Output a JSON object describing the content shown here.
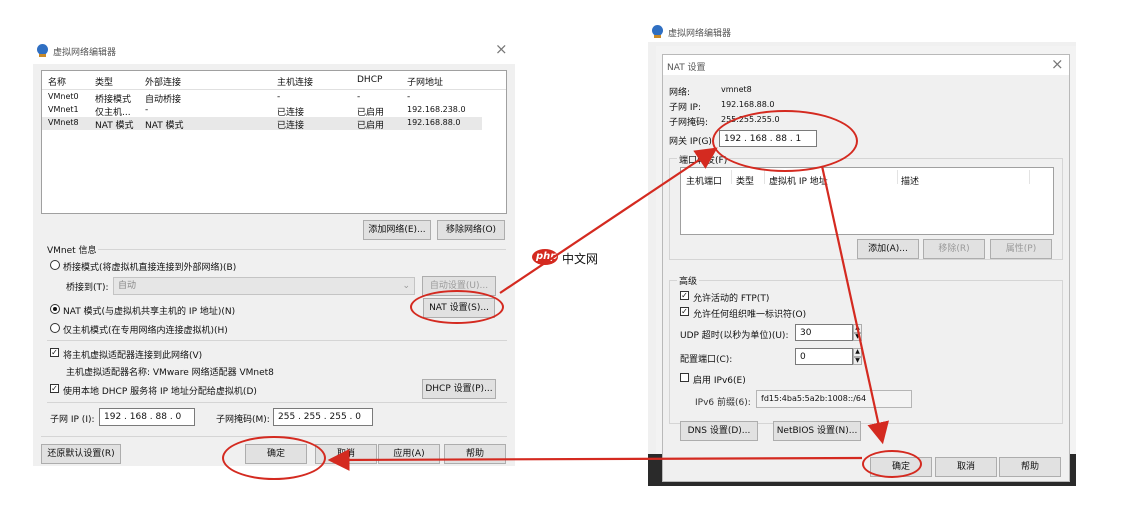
{
  "left": {
    "title": "虚拟网络编辑器",
    "close": "×",
    "table": {
      "headers": [
        "名称",
        "类型",
        "外部连接",
        "主机连接",
        "DHCP",
        "子网地址"
      ],
      "rows": [
        [
          "VMnet0",
          "桥接模式",
          "自动桥接",
          "-",
          "-",
          "-"
        ],
        [
          "VMnet1",
          "仅主机...",
          "-",
          "已连接",
          "已启用",
          "192.168.238.0"
        ],
        [
          "VMnet8",
          "NAT 模式",
          "NAT 模式",
          "已连接",
          "已启用",
          "192.168.88.0"
        ]
      ]
    },
    "add_network": "添加网络(E)...",
    "remove_network": "移除网络(O)",
    "vmnet_info": "VMnet 信息",
    "bridge_mode": "桥接模式(将虚拟机直接连接到外部网络)(B)",
    "bridge_to_label": "桥接到(T):",
    "bridge_to_value": "自动",
    "auto_settings": "自动设置(U)...",
    "nat_mode": "NAT 模式(与虚拟机共享主机的 IP 地址)(N)",
    "nat_settings": "NAT 设置(S)...",
    "host_only": "仅主机模式(在专用网络内连接虚拟机)(H)",
    "connect_adapter": "将主机虚拟适配器连接到此网络(V)",
    "adapter_name": "主机虚拟适配器名称: VMware 网络适配器 VMnet8",
    "use_dhcp": "使用本地 DHCP 服务将 IP 地址分配给虚拟机(D)",
    "dhcp_settings": "DHCP 设置(P)...",
    "subnet_ip_label": "子网 IP (I):",
    "subnet_ip_value": "192 . 168 . 88 . 0",
    "subnet_mask_label": "子网掩码(M):",
    "subnet_mask_value": "255 . 255 . 255 . 0",
    "restore_defaults": "还原默认设置(R)",
    "ok": "确定",
    "cancel": "取消",
    "apply": "应用(A)",
    "help": "帮助"
  },
  "right_back": {
    "title": "虚拟网络编辑器"
  },
  "nat": {
    "title": "NAT 设置",
    "close": "×",
    "network_label": "网络:",
    "network_value": "vmnet8",
    "subnet_ip_label": "子网 IP:",
    "subnet_ip_value": "192.168.88.0",
    "subnet_mask_label": "子网掩码:",
    "subnet_mask_value": "255.255.255.0",
    "gateway_label": "网关 IP(G):",
    "gateway_value": "192 . 168 . 88 . 1",
    "port_forward_label": "端口转发(F)",
    "pf_headers": [
      "主机端口",
      "类型",
      "虚拟机 IP 地址",
      "描述"
    ],
    "add": "添加(A)...",
    "remove": "移除(R)",
    "properties": "属性(P)",
    "advanced_label": "高级",
    "allow_ftp": "允许活动的 FTP(T)",
    "allow_oui": "允许任何组织唯一标识符(O)",
    "udp_timeout_label": "UDP 超时(以秒为单位)(U):",
    "udp_timeout_value": "30",
    "config_port_label": "配置端口(C):",
    "config_port_value": "0",
    "enable_ipv6": "启用 IPv6(E)",
    "ipv6_prefix_label": "IPv6 前缀(6):",
    "ipv6_prefix_value": "fd15:4ba5:5a2b:1008::/64",
    "dns_settings": "DNS 设置(D)...",
    "netbios_settings": "NetBIOS 设置(N)...",
    "ok": "确定",
    "cancel": "取消",
    "help": "帮助"
  },
  "watermark": {
    "logo": "php",
    "text": "中文网"
  },
  "annotation_color": "#d42a20"
}
